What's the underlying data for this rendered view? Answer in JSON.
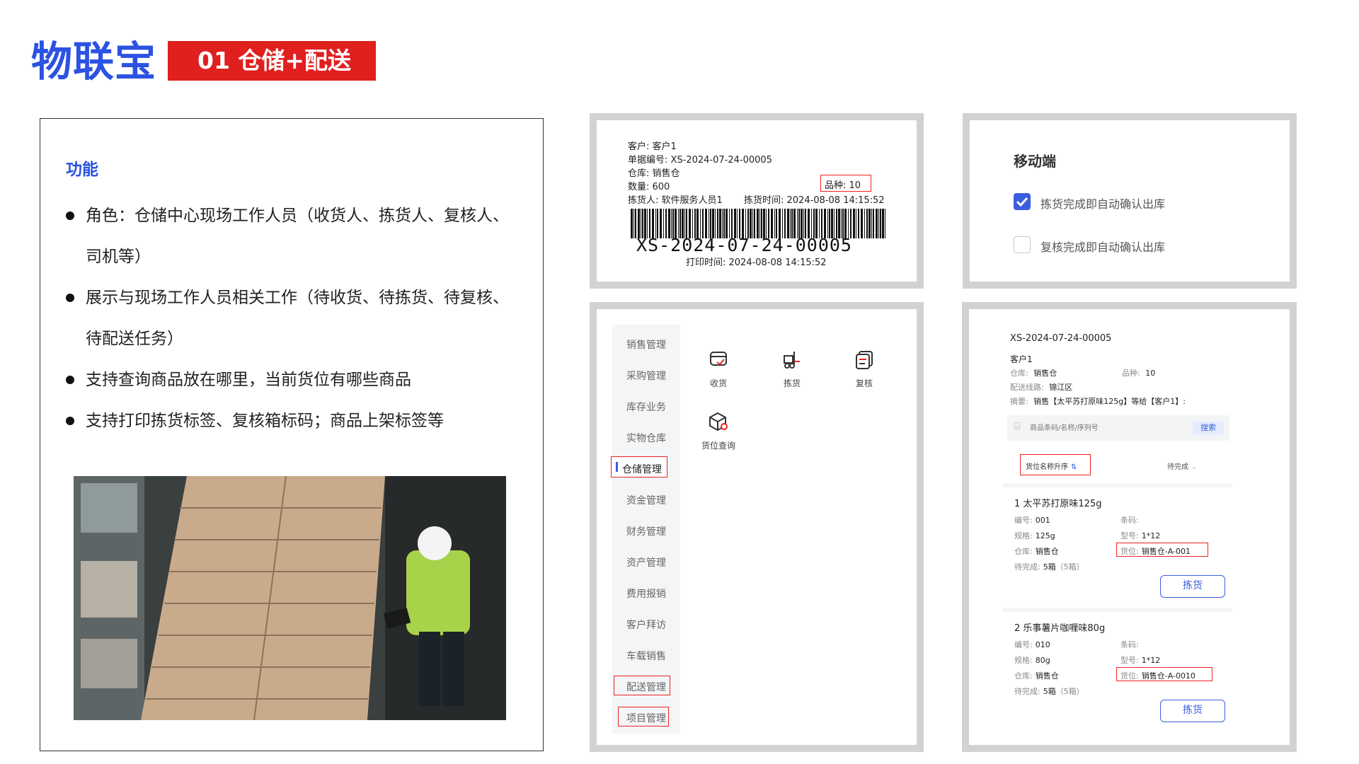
{
  "header": {
    "brand": "物联宝",
    "badge": "01 仓储+配送"
  },
  "features": {
    "title": "功能",
    "bullets": [
      "角色：仓储中心现场工作人员（收货人、拣货人、复核人、司机等）",
      "展示与现场工作人员相关工作（待收货、待拣货、待复核、待配送任务）",
      "支持查询商品放在哪里，当前货位有哪些商品",
      "支持打印拣货标签、复核箱标码；商品上架标签等"
    ]
  },
  "label_print": {
    "customer": "客户: 客户1",
    "doc_no": "单据编号: XS-2024-07-24-00005",
    "warehouse": "仓库: 销售仓",
    "quantity": "数量: 600",
    "variety": "品种: 10",
    "picker": "拣货人: 软件服务人员1",
    "pick_time": "拣货时间: 2024-08-08 14:15:52",
    "barcode_text": "XS-2024-07-24-00005",
    "print_time": "打印时间: 2024-08-08 14:15:52"
  },
  "mobile": {
    "title": "移动端",
    "options": [
      {
        "label": "拣货完成即自动确认出库",
        "checked": true
      },
      {
        "label": "复核完成即自动确认出库",
        "checked": false
      }
    ]
  },
  "menu": {
    "items": [
      "销售管理",
      "采购管理",
      "库存业务",
      "实物仓库",
      "仓储管理",
      "资金管理",
      "财务管理",
      "资产管理",
      "费用报销",
      "客户拜访",
      "车载销售",
      "配送管理",
      "项目管理"
    ],
    "actions": [
      {
        "label": "收货",
        "icon": "receive-icon"
      },
      {
        "label": "拣货",
        "icon": "forklift-icon"
      },
      {
        "label": "复核",
        "icon": "review-icon"
      },
      {
        "label": "货位查询",
        "icon": "box-search-icon"
      }
    ]
  },
  "pick_detail": {
    "doc_no": "XS-2024-07-24-00005",
    "customer": "客户1",
    "warehouse_label": "仓库:",
    "warehouse": "销售仓",
    "variety_label": "品种:",
    "variety": "10",
    "route_label": "配送线路:",
    "route": "锦江区",
    "summary_label": "摘要:",
    "summary": "销售【太平苏打原味125g】等给【客户1】:",
    "search_placeholder": "商品条码/名称/序列号",
    "search_button": "搜索",
    "sort_label": "货位名称升序",
    "filter_label": "待完成",
    "items": [
      {
        "title": "1  太平苏打原味125g",
        "code_label": "编号:",
        "code": "001",
        "barcode_label": "条码:",
        "spec_label": "规格:",
        "spec": "125g",
        "model_label": "型号:",
        "model": "1*12",
        "wh_label": "仓库:",
        "wh": "销售仓",
        "loc_label": "货位:",
        "loc": "销售仓-A-001",
        "todo_label": "待完成:",
        "todo": "5箱",
        "todo_extra": "（5箱）",
        "button": "拣货"
      },
      {
        "title": "2  乐事薯片咖喱味80g",
        "code_label": "编号:",
        "code": "010",
        "barcode_label": "条码:",
        "spec_label": "规格:",
        "spec": "80g",
        "model_label": "型号:",
        "model": "1*12",
        "wh_label": "仓库:",
        "wh": "销售仓",
        "loc_label": "货位:",
        "loc": "销售仓-A-0010",
        "todo_label": "待完成:",
        "todo": "5箱",
        "todo_extra": "（5箱）",
        "button": "拣货"
      }
    ]
  },
  "colors": {
    "brand_blue": "#2b52e2",
    "badge_red": "#e01f1f",
    "accent_blue": "#3b5ee0",
    "highlight_red": "#e22222",
    "frame_gray": "#d2d2d2"
  }
}
